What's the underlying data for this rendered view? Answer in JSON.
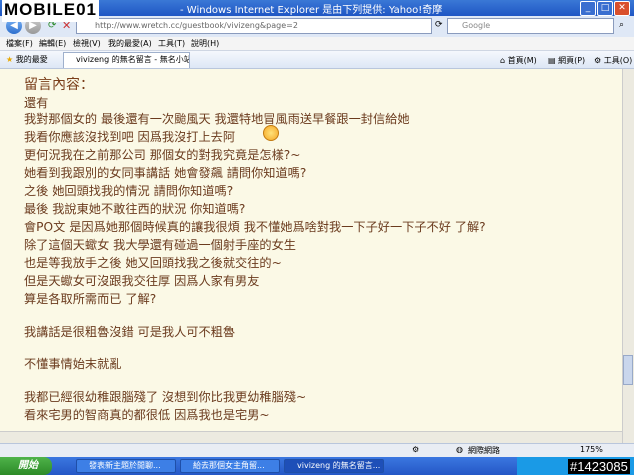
{
  "watermark": "MOBILE01",
  "window": {
    "title": "- Windows Internet Explorer 是由下列提供: Yahoo!奇摩"
  },
  "address": {
    "url": "http://www.wretch.cc/guestbook/vivizeng&page=2"
  },
  "search": {
    "placeholder": "Google"
  },
  "menubar": {
    "items": [
      "檔案(F)",
      "編輯(E)",
      "檢視(V)",
      "我的最愛(A)",
      "工具(T)",
      "說明(H)"
    ]
  },
  "favorites": {
    "label": "我的最愛"
  },
  "tab": {
    "label": "vivizeng 的無名留言 - 無名小站"
  },
  "toolbar_right": {
    "home": "首頁(M)",
    "page": "網頁(P)",
    "tools": "工具(O)"
  },
  "content": {
    "heading": "留言內容：",
    "lines": [
      "還有",
      "我對那個女的 最後還有一次颱風天 我還特地冒風雨送早餐跟一封信給她",
      "我看你應該沒找到吧 因爲我沒打上去阿",
      "更何況我在之前那公司 那個女的對我究竟是怎樣?~",
      "她看到我跟別的女同事講話 她會發飆 請問你知道嗎?",
      "之後 她回頭找我的情況 請問你知道嗎?",
      "最後 我說東她不敢往西的狀況 你知道嗎?",
      "會PO文 是因爲她那個時候真的讓我很煩 我不懂她爲啥對我一下子好一下子不好 了解?",
      "除了這個天蠍女 我大學還有碰過一個射手座的女生",
      "也是等我放手之後 她又回頭找我之後就交往的~",
      "但是天蠍女可沒跟我交往厚 因爲人家有男友",
      "算是各取所需而已 了解?",
      "",
      "我講話是很粗魯沒錯 可是我人可不粗魯",
      "",
      "不懂事情始末就亂",
      "",
      "我都已經很幼稚跟腦殘了 沒想到你比我更幼稚腦殘~",
      "看來宅男的智商真的都很低 因爲我也是宅男~"
    ]
  },
  "statusbar": {
    "zone": "網際網路",
    "zoom": "175%"
  },
  "taskbar": {
    "start": "開始",
    "tasks": [
      "發表新主題於閒聊...",
      "給去那個女主角留...",
      "vivizeng 的無名留言..."
    ]
  },
  "tag": "#1423085"
}
